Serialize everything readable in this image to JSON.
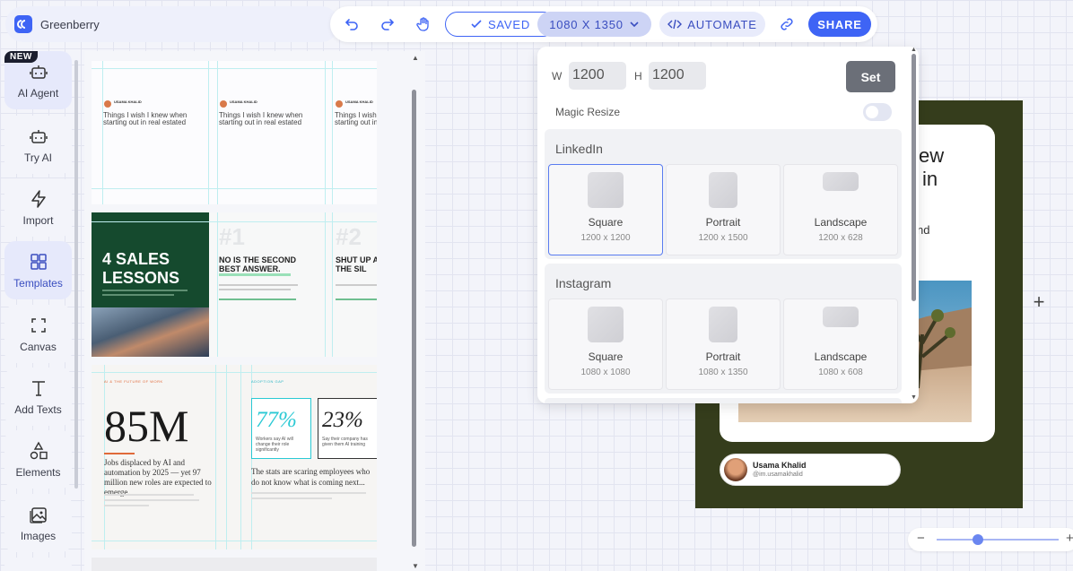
{
  "app": {
    "name": "Greenberry",
    "brand_color": "#3e64f5"
  },
  "toolbar": {
    "undo_icon": "undo-icon",
    "redo_icon": "redo-icon",
    "hand_icon": "hand-icon",
    "saved_label": "SAVED",
    "size_label": "1080 X 1350",
    "automate_label": "AUTOMATE",
    "link_icon": "link-icon",
    "share_label": "SHARE"
  },
  "rail": {
    "new_badge": "NEW",
    "items": [
      {
        "label": "AI Agent",
        "icon": "robot-icon"
      },
      {
        "label": "Try AI",
        "icon": "robot-icon"
      },
      {
        "label": "Import",
        "icon": "lightning-icon"
      },
      {
        "label": "Templates",
        "icon": "grid-icon"
      },
      {
        "label": "Canvas",
        "icon": "frame-icon"
      },
      {
        "label": "Add Texts",
        "icon": "text-icon"
      },
      {
        "label": "Elements",
        "icon": "shapes-icon"
      },
      {
        "label": "Images",
        "icon": "image-icon"
      }
    ]
  },
  "templates": {
    "t1": {
      "slide_text": "Things I wish I knew when starting out in real estated",
      "author": "USAMA KHALID"
    },
    "t2": {
      "headline": "4 SALES LESSONS",
      "num1": "#1",
      "lesson1": "NO IS THE SECOND BEST ANSWER.",
      "num2": "#2",
      "lesson2": "SHUT UP AND TO THE SIL"
    },
    "t3": {
      "kicker": "AI & THE FUTURE OF WORK",
      "big": "85M",
      "body": "Jobs displaced by AI and automation by 2025 — yet 97 million new roles are expected to emerge.",
      "kicker2": "ADOPTION GAP",
      "stat1": "77%",
      "stat1_text": "Workers say AI will change their role significantly",
      "stat2": "23%",
      "stat2_text": "Say their company has given them AI training",
      "body2": "The stats are scaring employees who do not know what is coming next..."
    }
  },
  "resize": {
    "w_label": "W",
    "w_value": "1200",
    "h_label": "H",
    "h_value": "1200",
    "set_label": "Set",
    "magic_label": "Magic Resize",
    "groups": [
      {
        "name": "LinkedIn",
        "presets": [
          {
            "name": "Square",
            "dims": "1200 x 1200"
          },
          {
            "name": "Portrait",
            "dims": "1200 x 1500"
          },
          {
            "name": "Landscape",
            "dims": "1200 x 628"
          }
        ]
      },
      {
        "name": "Instagram",
        "presets": [
          {
            "name": "Square",
            "dims": "1080 x 1080"
          },
          {
            "name": "Portrait",
            "dims": "1080 x 1350"
          },
          {
            "name": "Landscape",
            "dims": "1080 x 608"
          }
        ]
      }
    ]
  },
  "canvas": {
    "heading_partial_1": "ew",
    "heading_partial_2": "in",
    "text_partial": "nd",
    "author_name": "Usama Khalid",
    "author_handle": "@im.usamakhalid",
    "add_icon": "plus-icon",
    "zoom_out": "−",
    "zoom_in": "+"
  }
}
